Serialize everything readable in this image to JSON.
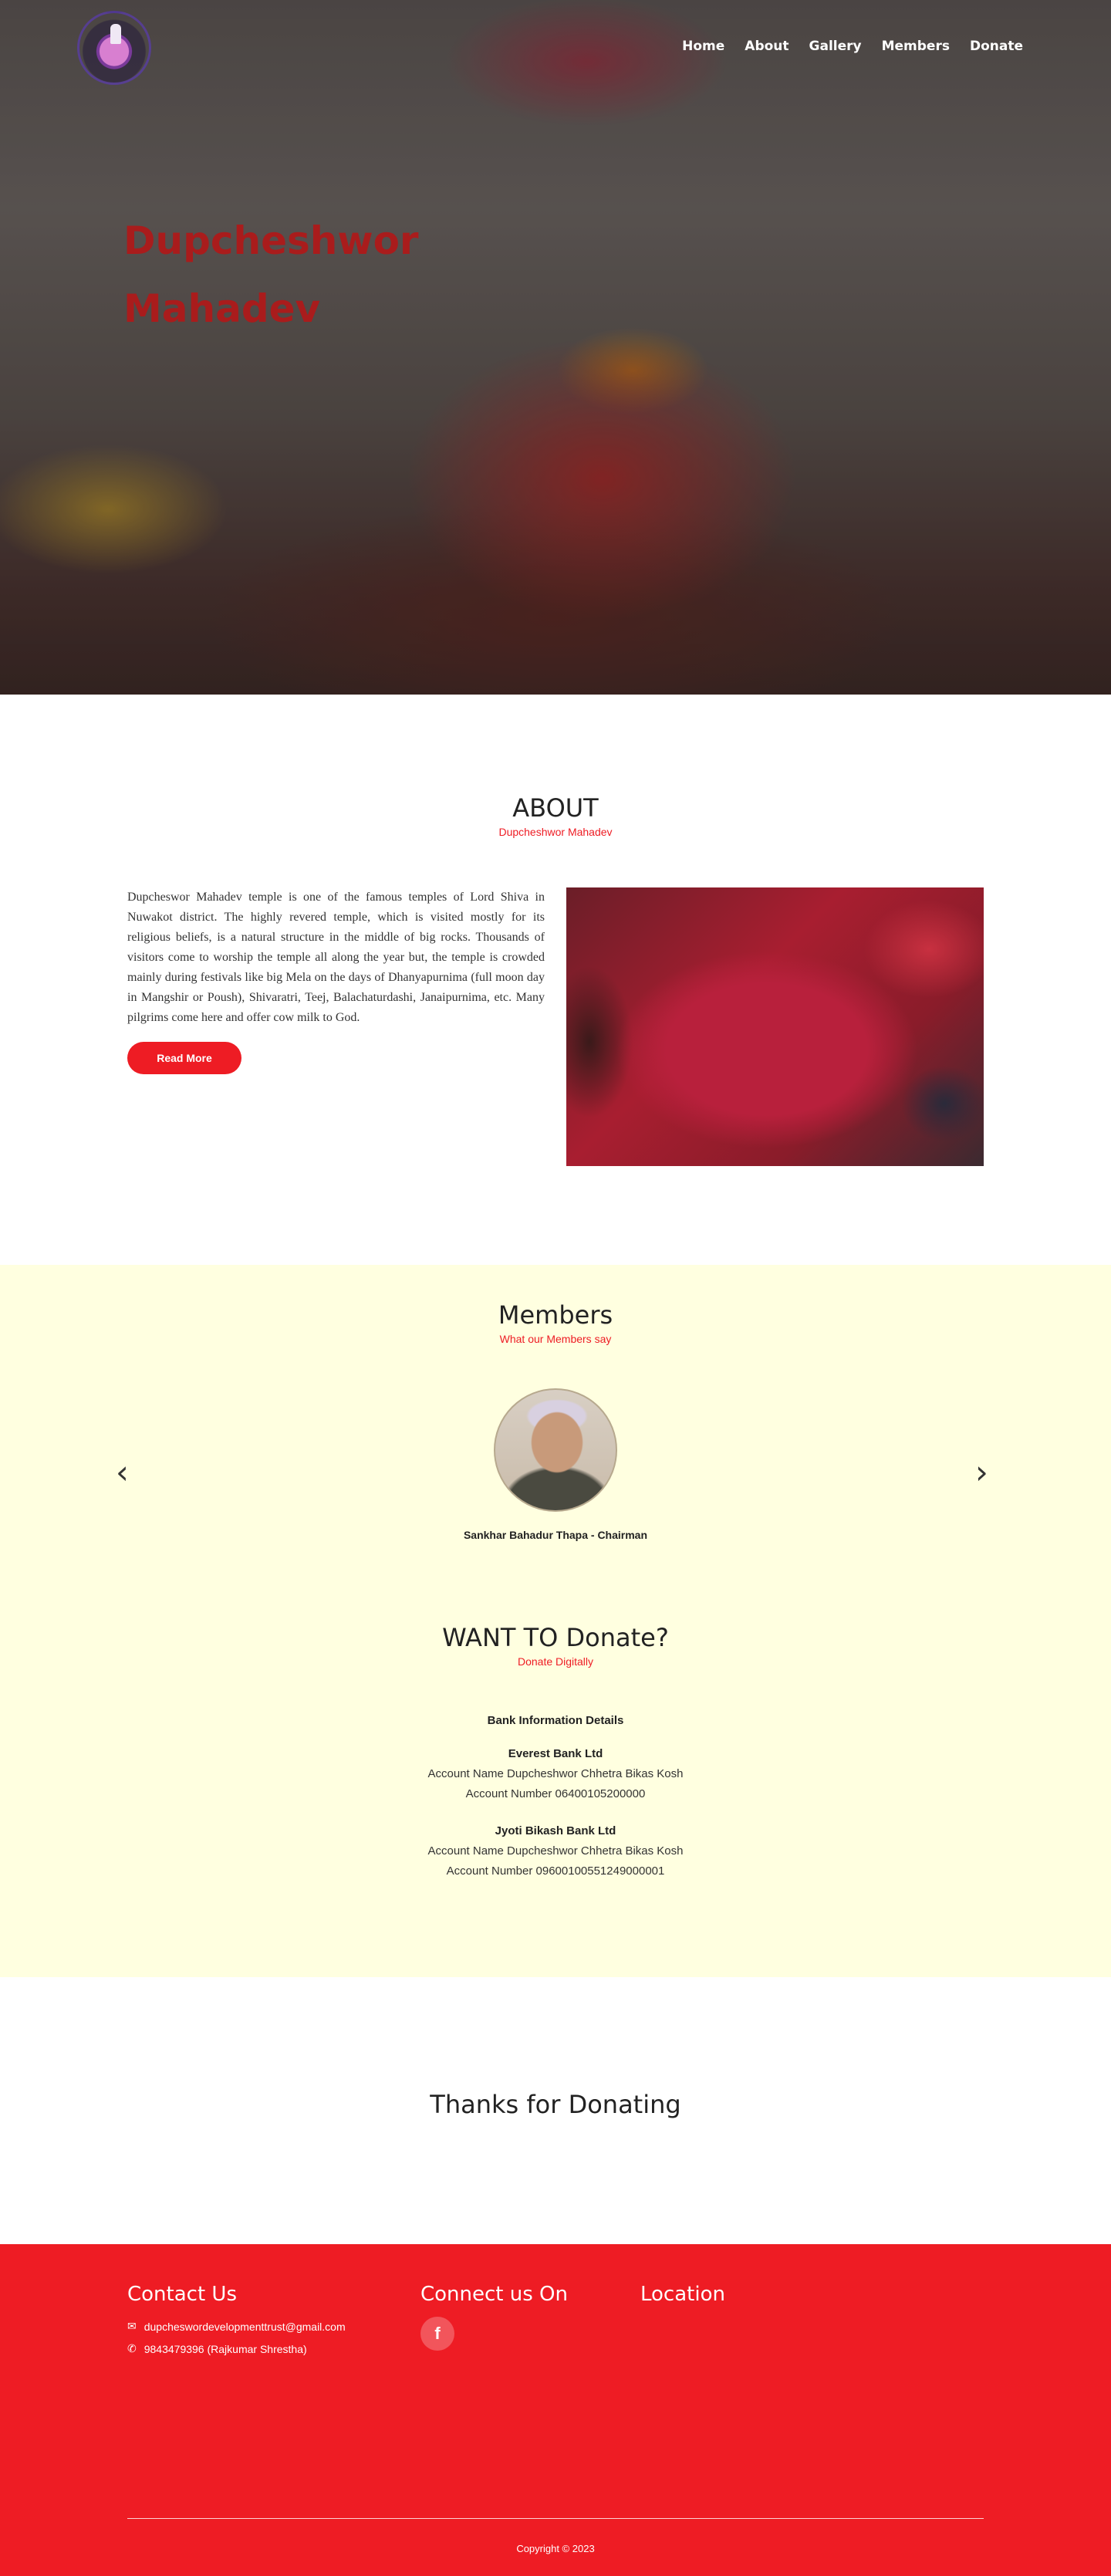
{
  "nav": {
    "items": [
      "Home",
      "About",
      "Gallery",
      "Members",
      "Donate"
    ]
  },
  "hero": {
    "title_line1": "Dupcheshwor",
    "title_line2": "Mahadev"
  },
  "about": {
    "title": "ABOUT",
    "subtitle": "Dupcheshwor Mahadev",
    "paragraph": "Dupcheswor Mahadev temple is one of the famous temples of Lord Shiva in Nuwakot district. The highly revered temple, which is visited mostly for its religious beliefs, is a natural structure in the middle of big rocks. Thousands of visitors come to worship the temple all along the year but, the temple is crowded mainly during festivals like big Mela on the days of Dhanyapurnima (full moon day in Mangshir or Poush), Shivaratri, Teej, Balachaturdashi, Janaipurnima, etc. Many pilgrims come here and offer cow milk to God.",
    "button": "Read More"
  },
  "members": {
    "title": "Members",
    "subtitle": "What our Members say",
    "prev": "‹",
    "next": "›",
    "name": "Sankhar Bahadur Thapa - Chairman"
  },
  "donate": {
    "title": "WANT TO Donate?",
    "subtitle": "Donate Digitally",
    "bank_heading": "Bank Information Details",
    "banks": [
      {
        "name": "Everest Bank Ltd",
        "account_name": "Account Name Dupcheshwor Chhetra Bikas Kosh",
        "account_number": "Account Number 06400105200000"
      },
      {
        "name": "Jyoti Bikash Bank Ltd",
        "account_name": "Account Name Dupcheshwor Chhetra Bikas Kosh",
        "account_number": "Account Number 09600100551249000001"
      }
    ]
  },
  "thanks": {
    "title": "Thanks for Donating"
  },
  "footer": {
    "contact_title": "Contact Us",
    "email": "dupcheswordevelopmenttrust@gmail.com",
    "phone": "9843479396 (Rajkumar Shrestha)",
    "connect_title": "Connect us On",
    "facebook": "f",
    "location_title": "Location",
    "copyright": "Copyright © 2023"
  },
  "colors": {
    "accent": "#ee1c24",
    "hero_title": "#a91c1c",
    "members_bg": "#ffffe0"
  },
  "icons": {
    "email": "envelope-icon",
    "phone": "phone-icon",
    "facebook": "facebook-icon"
  }
}
